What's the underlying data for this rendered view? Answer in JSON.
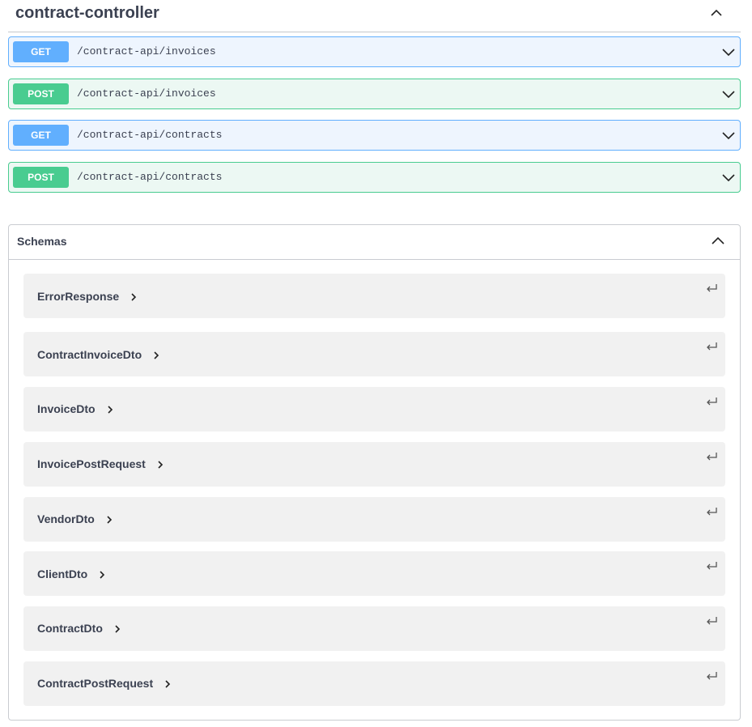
{
  "tag": {
    "title": "contract-controller"
  },
  "operations": [
    {
      "method": "GET",
      "path": "/contract-api/invoices"
    },
    {
      "method": "POST",
      "path": "/contract-api/invoices"
    },
    {
      "method": "GET",
      "path": "/contract-api/contracts"
    },
    {
      "method": "POST",
      "path": "/contract-api/contracts"
    }
  ],
  "schemas": {
    "title": "Schemas",
    "models": [
      {
        "name": "ErrorResponse"
      },
      {
        "name": "ContractInvoiceDto"
      },
      {
        "name": "InvoiceDto"
      },
      {
        "name": "InvoicePostRequest"
      },
      {
        "name": "VendorDto"
      },
      {
        "name": "ClientDto"
      },
      {
        "name": "ContractDto"
      },
      {
        "name": "ContractPostRequest"
      }
    ]
  },
  "colors": {
    "get": "#61affe",
    "post": "#49cc90",
    "text": "#3b4151",
    "model_bg": "#f1f1f1"
  }
}
